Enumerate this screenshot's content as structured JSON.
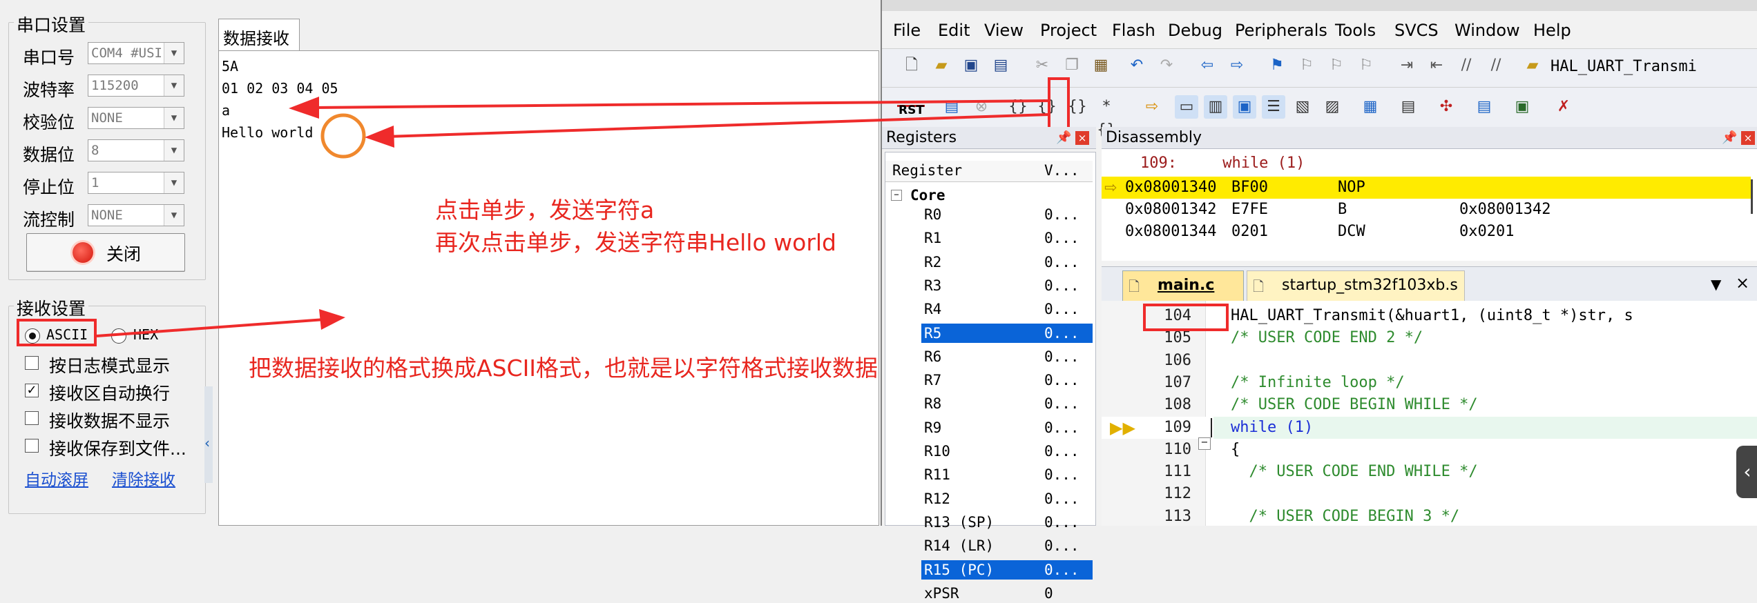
{
  "serial": {
    "title": "串口设置",
    "fields": [
      {
        "label": "串口号",
        "value": "COM4 #USI"
      },
      {
        "label": "波特率",
        "value": "115200"
      },
      {
        "label": "校验位",
        "value": "NONE"
      },
      {
        "label": "数据位",
        "value": "8"
      },
      {
        "label": "停止位",
        "value": "1"
      },
      {
        "label": "流控制",
        "value": "NONE"
      }
    ],
    "close_button": "关闭"
  },
  "receive_settings": {
    "title": "接收设置",
    "ascii": "ASCII",
    "hex": "HEX",
    "options": [
      {
        "label": "按日志模式显示",
        "checked": false
      },
      {
        "label": "接收区自动换行",
        "checked": true
      },
      {
        "label": "接收数据不显示",
        "checked": false
      },
      {
        "label": "接收保存到文件...",
        "checked": false
      }
    ],
    "auto_scroll": "自动滚屏",
    "clear_receive": "清除接收"
  },
  "receive": {
    "tab": "数据接收",
    "lines": [
      "5A",
      "01 02 03 04 05",
      "a",
      "Hello world"
    ]
  },
  "annotations": {
    "step1": "点击单步，发送字符a",
    "step2": "再次点击单步，发送字符串Hello world",
    "format": "把数据接收的格式换成ASCII格式，也就是以字符格式接收数据"
  },
  "ide": {
    "menu": [
      "File",
      "Edit",
      "View",
      "Project",
      "Flash",
      "Debug",
      "Peripherals",
      "Tools",
      "SVCS",
      "Window",
      "Help"
    ],
    "toolbar_text": "HAL_UART_Transmi",
    "rst_label": "RST",
    "registers": {
      "title": "Registers",
      "col_register": "Register",
      "col_value": "V...",
      "group": "Core",
      "items": [
        {
          "name": "R0",
          "value": "0..."
        },
        {
          "name": "R1",
          "value": "0..."
        },
        {
          "name": "R2",
          "value": "0..."
        },
        {
          "name": "R3",
          "value": "0..."
        },
        {
          "name": "R4",
          "value": "0..."
        },
        {
          "name": "R5",
          "value": "0..."
        },
        {
          "name": "R6",
          "value": "0..."
        },
        {
          "name": "R7",
          "value": "0..."
        },
        {
          "name": "R8",
          "value": "0..."
        },
        {
          "name": "R9",
          "value": "0..."
        },
        {
          "name": "R10",
          "value": "0..."
        },
        {
          "name": "R11",
          "value": "0..."
        },
        {
          "name": "R12",
          "value": "0..."
        },
        {
          "name": "R13 (SP)",
          "value": "0..."
        },
        {
          "name": "R14 (LR)",
          "value": "0..."
        },
        {
          "name": "R15 (PC)",
          "value": "0..."
        },
        {
          "name": "xPSR",
          "value": "0"
        }
      ]
    },
    "disassembly": {
      "title": "Disassembly",
      "source_line": "109:     while (1)",
      "rows": [
        {
          "addr": "0x08001340",
          "op": "BF00",
          "mn": "NOP",
          "arg": ""
        },
        {
          "addr": "0x08001342",
          "op": "E7FE",
          "mn": "B",
          "arg": "0x08001342"
        },
        {
          "addr": "0x08001344",
          "op": "0201",
          "mn": "DCW",
          "arg": "0x0201"
        }
      ]
    },
    "tabs": [
      "main.c",
      "startup_stm32f103xb.s"
    ],
    "code": [
      {
        "n": "104",
        "text": "HAL_UART_Transmit(&huart1, (uint8_t *)str, s",
        "cls": ""
      },
      {
        "n": "105",
        "text": "/* USER CODE END 2 */",
        "cls": "cmt"
      },
      {
        "n": "106",
        "text": "",
        "cls": ""
      },
      {
        "n": "107",
        "text": "/* Infinite loop */",
        "cls": "cmt"
      },
      {
        "n": "108",
        "text": "/* USER CODE BEGIN WHILE */",
        "cls": "cmt"
      },
      {
        "n": "109",
        "text": "while (1)",
        "cls": "kw"
      },
      {
        "n": "110",
        "text": "{",
        "cls": ""
      },
      {
        "n": "111",
        "text": "  /* USER CODE END WHILE */",
        "cls": "cmt"
      },
      {
        "n": "112",
        "text": "",
        "cls": ""
      },
      {
        "n": "113",
        "text": "  /* USER CODE BEGIN 3 */",
        "cls": "cmt"
      }
    ]
  }
}
